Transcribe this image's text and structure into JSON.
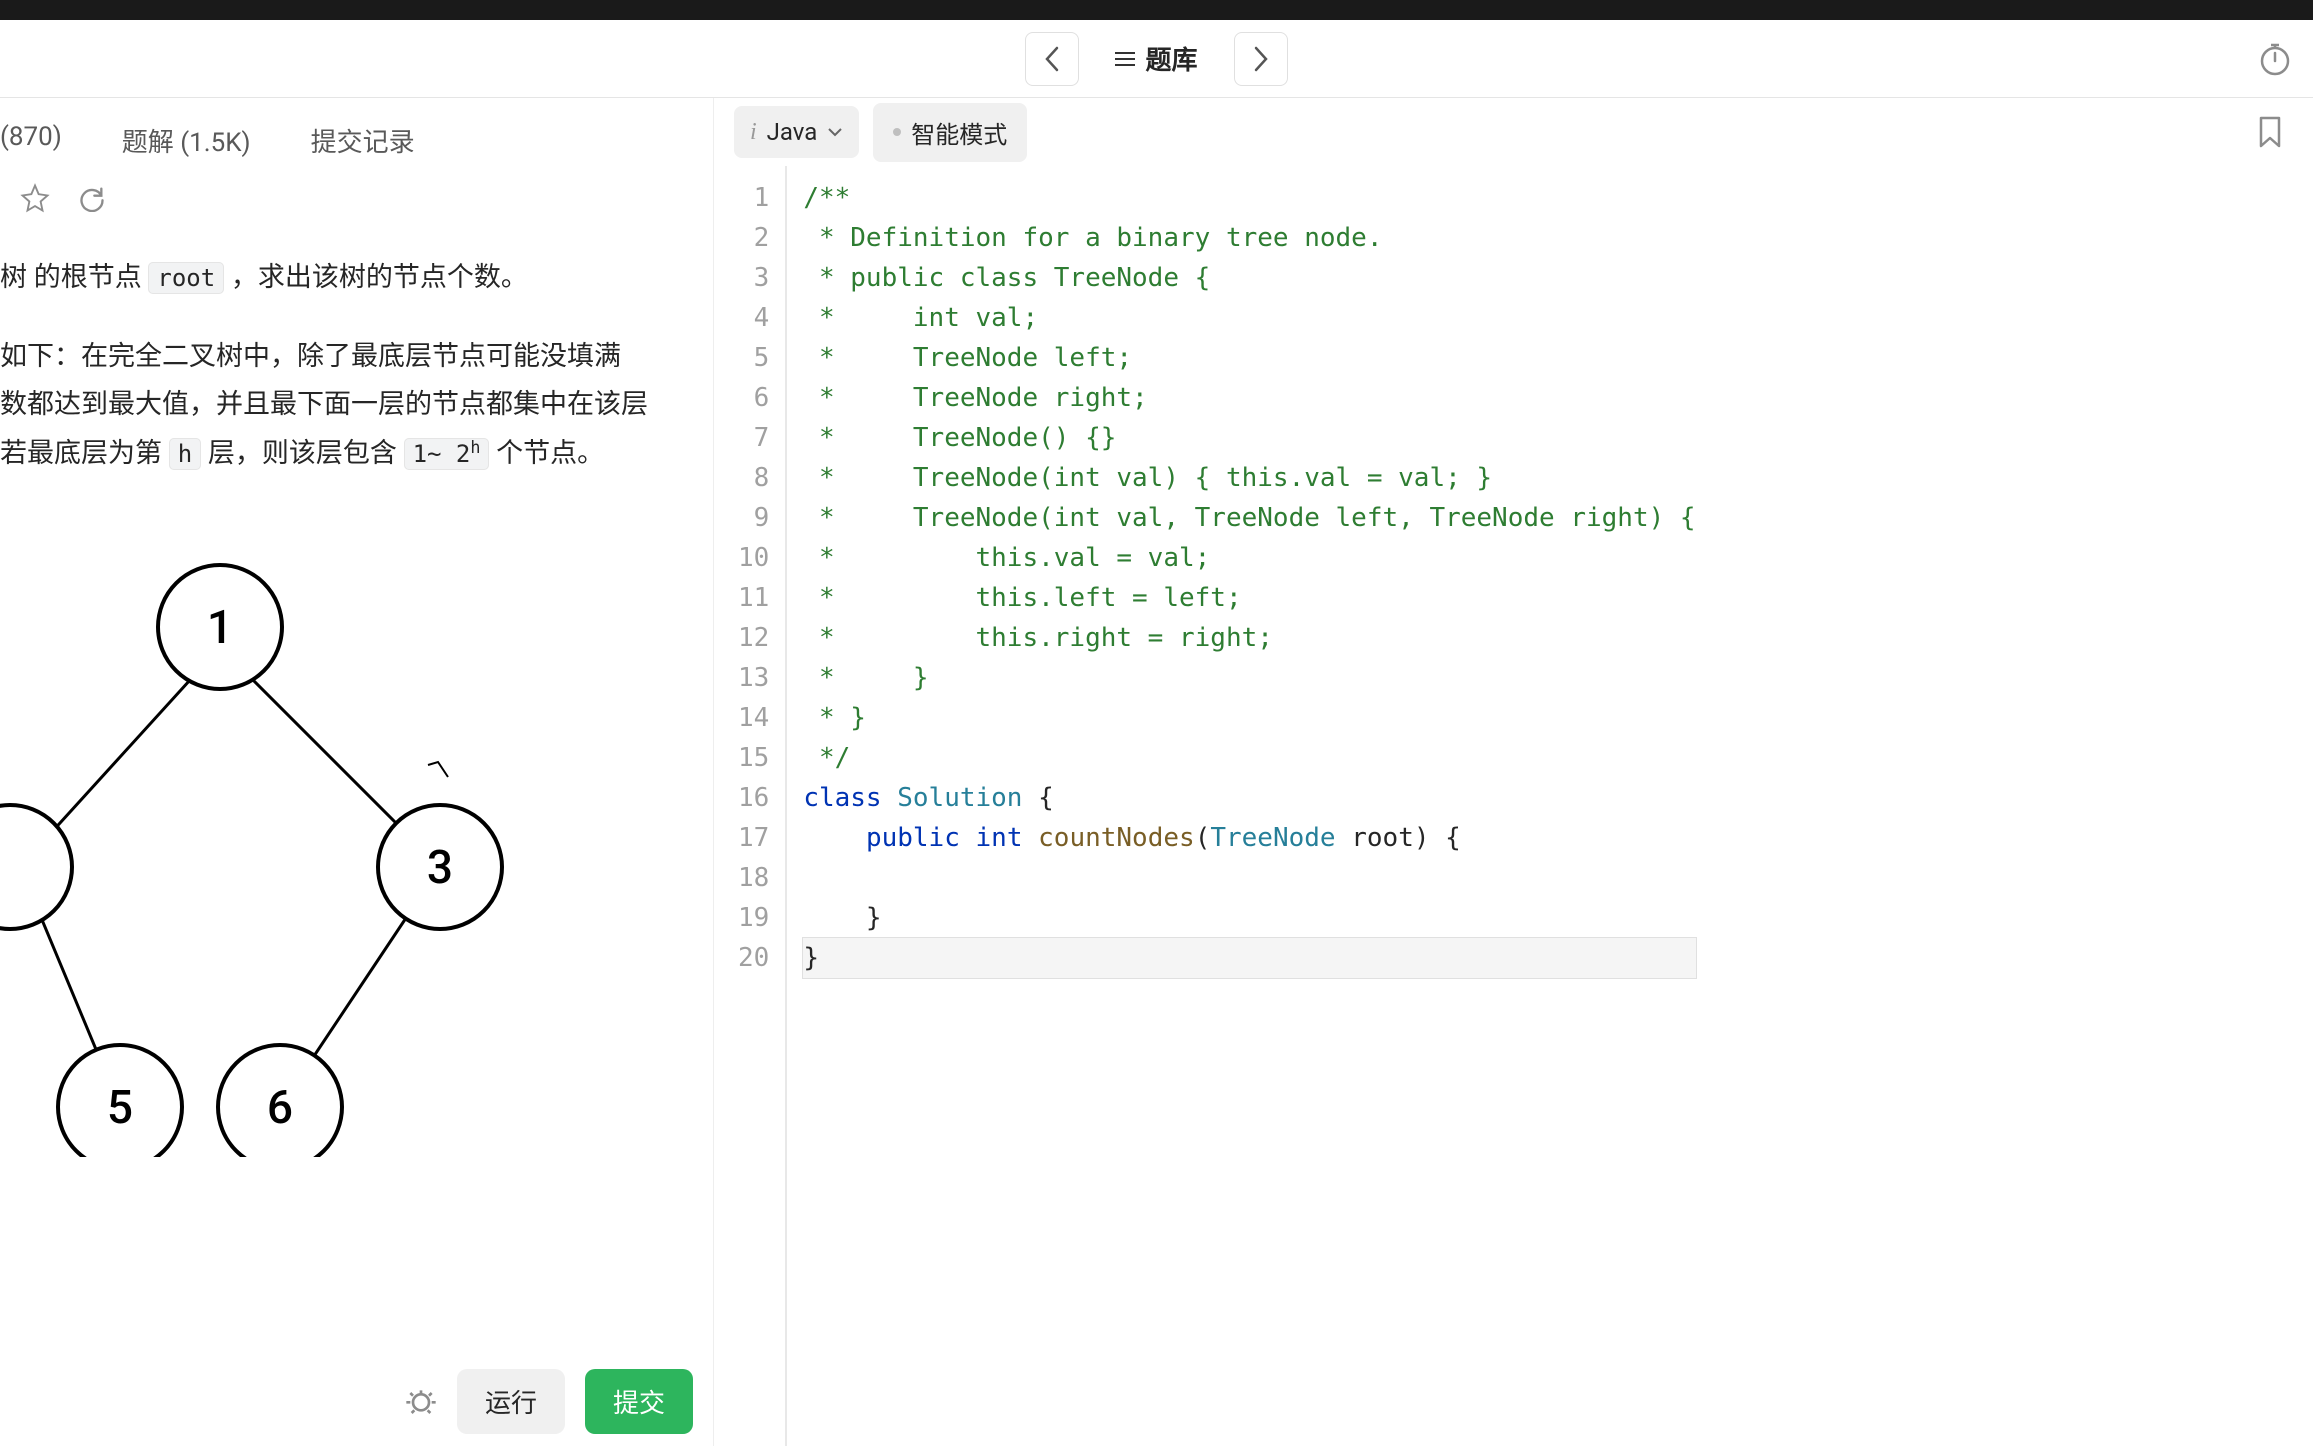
{
  "header": {
    "back_label": "返回",
    "forward_label": "前进",
    "center_label": "题库"
  },
  "tabs": {
    "comments": "(870)",
    "solutions": "题解 (1.5K)",
    "submissions": "提交记录"
  },
  "problem": {
    "line1_a": "树 的根节点 ",
    "line1_code": "root",
    "line1_b": " ，求出该树的节点个数。",
    "line2": "如下：在完全二叉树中，除了最底层节点可能没填满",
    "line3": "数都达到最大值，并且最下面一层的节点都集中在该层",
    "line4_a": "若最底层为第 ",
    "line4_h": "h",
    "line4_b": " 层，则该层包含 ",
    "line4_range_a": "1~ 2",
    "line4_range_sup": "h",
    "line4_c": " 个节点。"
  },
  "tree": {
    "n1": "1",
    "n3": "3",
    "n5": "5",
    "n6": "6"
  },
  "footer": {
    "run": "运行",
    "submit": "提交"
  },
  "editor": {
    "language": "Java",
    "mode": "智能模式",
    "lines": [
      {
        "n": "1",
        "t": "/**",
        "cls": "comment"
      },
      {
        "n": "2",
        "t": " * Definition for a binary tree node.",
        "cls": "comment"
      },
      {
        "n": "3",
        "t": " * public class TreeNode {",
        "cls": "comment"
      },
      {
        "n": "4",
        "t": " *     int val;",
        "cls": "comment"
      },
      {
        "n": "5",
        "t": " *     TreeNode left;",
        "cls": "comment"
      },
      {
        "n": "6",
        "t": " *     TreeNode right;",
        "cls": "comment"
      },
      {
        "n": "7",
        "t": " *     TreeNode() {}",
        "cls": "comment"
      },
      {
        "n": "8",
        "t": " *     TreeNode(int val) { this.val = val; }",
        "cls": "comment"
      },
      {
        "n": "9",
        "t": " *     TreeNode(int val, TreeNode left, TreeNode right) {",
        "cls": "comment"
      },
      {
        "n": "10",
        "t": " *         this.val = val;",
        "cls": "comment"
      },
      {
        "n": "11",
        "t": " *         this.left = left;",
        "cls": "comment"
      },
      {
        "n": "12",
        "t": " *         this.right = right;",
        "cls": "comment"
      },
      {
        "n": "13",
        "t": " *     }",
        "cls": "comment"
      },
      {
        "n": "14",
        "t": " * }",
        "cls": "comment"
      },
      {
        "n": "15",
        "t": " */",
        "cls": "comment"
      },
      {
        "n": "16",
        "tokens": [
          {
            "t": "class ",
            "cls": "kw"
          },
          {
            "t": "Solution",
            "cls": "type"
          },
          {
            "t": " {",
            "cls": ""
          }
        ]
      },
      {
        "n": "17",
        "tokens": [
          {
            "t": "    ",
            "cls": ""
          },
          {
            "t": "public ",
            "cls": "kw"
          },
          {
            "t": "int ",
            "cls": "kw"
          },
          {
            "t": "countNodes",
            "cls": "ident"
          },
          {
            "t": "(",
            "cls": ""
          },
          {
            "t": "TreeNode",
            "cls": "type"
          },
          {
            "t": " root) {",
            "cls": ""
          }
        ]
      },
      {
        "n": "18",
        "t": "",
        "cls": ""
      },
      {
        "n": "19",
        "t": "    }",
        "cls": ""
      },
      {
        "n": "20",
        "t": "}",
        "cls": "",
        "cursor": true
      }
    ]
  }
}
